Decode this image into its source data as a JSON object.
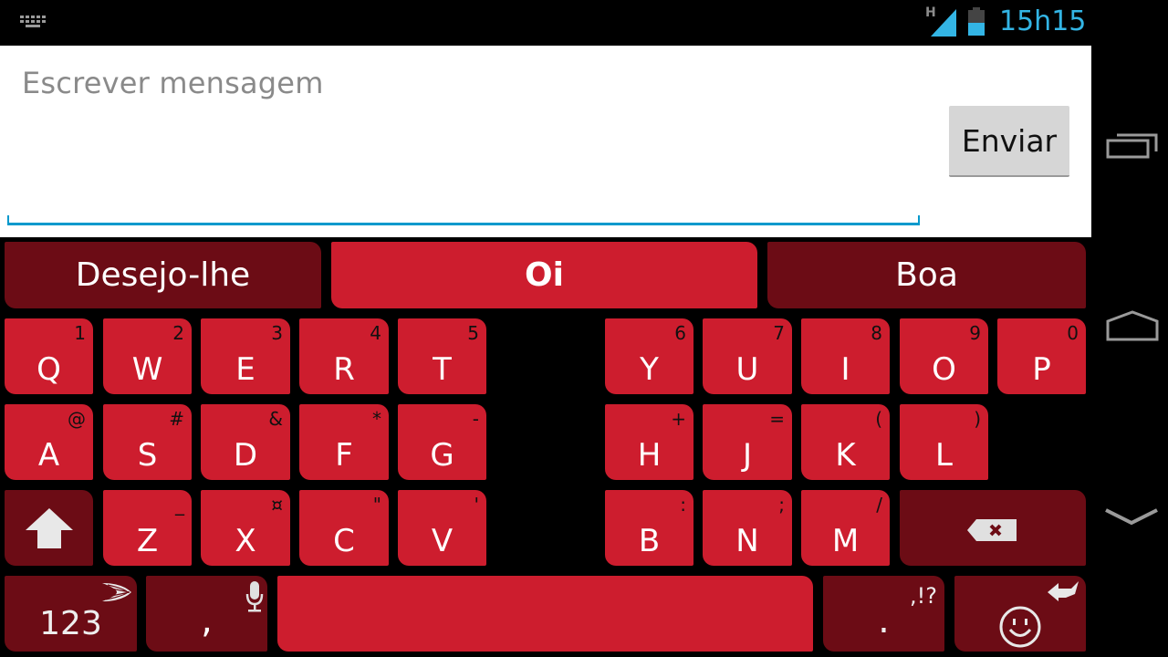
{
  "status_bar": {
    "time": "15h15",
    "network_type": "H",
    "icons": [
      "keyboard-icon",
      "signal-icon",
      "battery-icon"
    ],
    "accent_color": "#33b5e5"
  },
  "compose": {
    "placeholder": "Escrever mensagem",
    "value": "",
    "send_label": "Enviar"
  },
  "keyboard": {
    "key_color": "#cd1d2e",
    "dark_key_color": "#6c0c15",
    "suggestions": [
      {
        "label": "Desejo-lhe",
        "selected": false
      },
      {
        "label": "Oi",
        "selected": true
      },
      {
        "label": "Boa",
        "selected": false
      }
    ],
    "rows": [
      [
        {
          "main": "Q",
          "alt": "1"
        },
        {
          "main": "W",
          "alt": "2"
        },
        {
          "main": "E",
          "alt": "3"
        },
        {
          "main": "R",
          "alt": "4"
        },
        {
          "main": "T",
          "alt": "5"
        },
        {
          "main": "Y",
          "alt": "6"
        },
        {
          "main": "U",
          "alt": "7"
        },
        {
          "main": "I",
          "alt": "8"
        },
        {
          "main": "O",
          "alt": "9"
        },
        {
          "main": "P",
          "alt": "0"
        }
      ],
      [
        {
          "main": "A",
          "alt": "@"
        },
        {
          "main": "S",
          "alt": "#"
        },
        {
          "main": "D",
          "alt": "&"
        },
        {
          "main": "F",
          "alt": "*"
        },
        {
          "main": "G",
          "alt": "-"
        },
        {
          "main": "H",
          "alt": "+"
        },
        {
          "main": "J",
          "alt": "="
        },
        {
          "main": "K",
          "alt": "("
        },
        {
          "main": "L",
          "alt": ")"
        }
      ],
      [
        {
          "main": "Z",
          "alt": "_"
        },
        {
          "main": "X",
          "alt": "¤"
        },
        {
          "main": "C",
          "alt": "\""
        },
        {
          "main": "V",
          "alt": "'"
        },
        {
          "main": "B",
          "alt": ":"
        },
        {
          "main": "N",
          "alt": ";"
        },
        {
          "main": "M",
          "alt": "/"
        }
      ]
    ],
    "bottom": {
      "numbers_label": "123",
      "comma_label": ",",
      "period_label": ".",
      "period_alt": ",!?"
    }
  },
  "nav_bar": {
    "buttons": [
      "recents-icon",
      "home-icon",
      "back-icon"
    ]
  }
}
